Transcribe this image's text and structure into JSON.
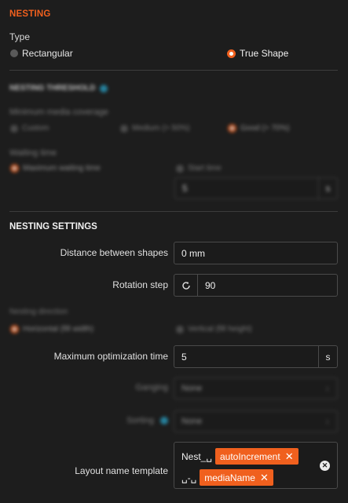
{
  "nesting": {
    "title": "NESTING",
    "type_label": "Type",
    "type_options": [
      "Rectangular",
      "True Shape"
    ],
    "type_selected": "True Shape"
  },
  "threshold": {
    "title": "NESTING THRESHOLD",
    "coverage_label": "Minimum media coverage",
    "coverage_options": [
      "Custom",
      "Medium (> 50%)",
      "Good (> 70%)"
    ],
    "coverage_selected": "Good (> 70%)",
    "waiting_label": "Waiting time",
    "waiting_options": [
      "Maximum waiting time",
      "Start time"
    ],
    "waiting_selected": "Maximum waiting time",
    "waiting_value": "5",
    "waiting_unit": "s"
  },
  "settings": {
    "title": "NESTING SETTINGS",
    "distance_label": "Distance between shapes",
    "distance_value": "0 mm",
    "rotation_label": "Rotation step",
    "rotation_value": "90",
    "direction_label": "Nesting direction",
    "direction_options": [
      "Horizontal (fill width)",
      "Vertical (fill height)"
    ],
    "direction_selected": "Horizontal (fill width)",
    "max_opt_label": "Maximum optimization time",
    "max_opt_value": "5",
    "max_opt_unit": "s",
    "ganging_label": "Ganging",
    "ganging_value": "None",
    "sorting_label": "Sorting",
    "sorting_value": "None",
    "layout_label": "Layout name template",
    "template_line1_text": "Nest_␣",
    "template_chip1": "autoIncrement",
    "template_line2_text": "␣-␣",
    "template_chip2": "mediaName"
  },
  "colors": {
    "accent": "#f0601e",
    "info": "#29a3c8",
    "background": "#1d1d1d"
  },
  "icons": [
    "refresh-icon",
    "info-icon",
    "close-icon",
    "clear-icon",
    "chevron-updown-icon"
  ]
}
